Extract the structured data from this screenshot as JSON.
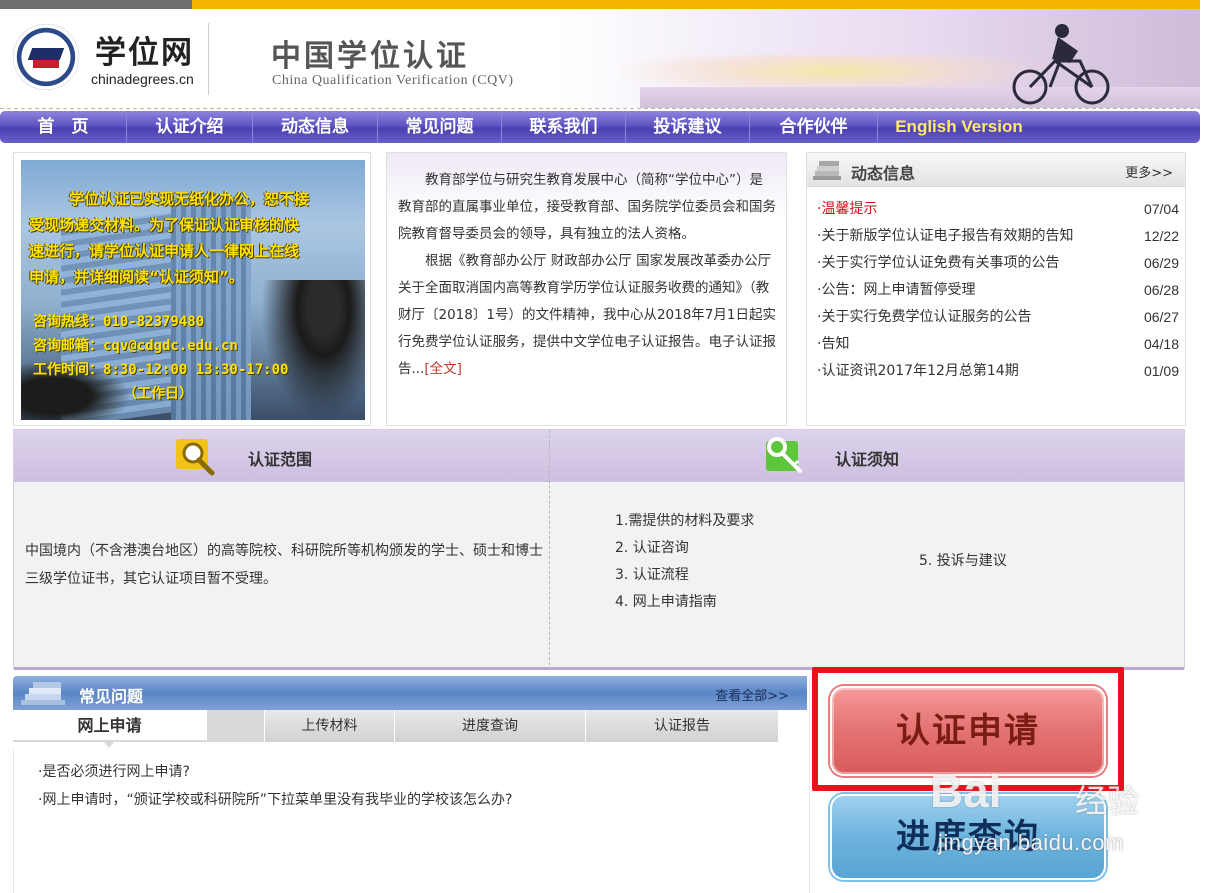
{
  "header": {
    "site_name": "学位网",
    "site_domain": "chinadegrees.cn",
    "title_cn": "中国学位认证",
    "title_en": "China Qualification Verification (CQV)"
  },
  "nav": {
    "items": [
      "首　页",
      "认证介绍",
      "动态信息",
      "常见问题",
      "联系我们",
      "投诉建议",
      "合作伙伴",
      "English Version"
    ]
  },
  "promo": {
    "lines": [
      "学位认证已实现无纸化办公，恕不接",
      "受现场递交材料。为了保证认证审核的快",
      "速进行，请学位认证申请人一律网上在线",
      "申请，并详细阅读“认证须知”。"
    ],
    "hotline": "咨询热线：010-82379480",
    "email": "咨询邮箱：cqv@cdgdc.edu.cn",
    "hours": "工作时间：8:30-12:00 13:30-17:00",
    "workday": "（工作日）"
  },
  "intro": {
    "para1": "教育部学位与研究生教育发展中心（简称“学位中心”）是教育部的直属事业单位，接受教育部、国务院学位委员会和国务院教育督导委员会的领导，具有独立的法人资格。",
    "para2": "根据《教育部办公厅 财政部办公厅 国家发展改革委办公厅关于全面取消国内高等教育学历学位认证服务收费的通知》（教财厅〔2018〕1号）的文件精神，我中心从2018年7月1日起实行免费学位认证服务，提供中文学位电子认证报告。电子认证报告...",
    "more": "[全文]"
  },
  "news": {
    "title": "动态信息",
    "more": "更多>>",
    "items": [
      {
        "title": "·温馨提示",
        "date": "07/04"
      },
      {
        "title": "·关于新版学位认证电子报告有效期的告知",
        "date": "12/22"
      },
      {
        "title": "·关于实行学位认证免费有关事项的公告",
        "date": "06/29"
      },
      {
        "title": "·公告：网上申请暂停受理",
        "date": "06/28"
      },
      {
        "title": "·关于实行免费学位认证服务的公告",
        "date": "06/27"
      },
      {
        "title": "·告知",
        "date": "04/18"
      },
      {
        "title": "·认证资讯2017年12月总第14期",
        "date": "01/09"
      }
    ]
  },
  "scope": {
    "title": "认证范围",
    "text": "中国境内（不含港澳台地区）的高等院校、科研院所等机构颁发的学士、硕士和博士三级学位证书，其它认证项目暂不受理。"
  },
  "notice": {
    "title": "认证须知",
    "items": [
      "1.需提供的材料及要求",
      "2. 认证咨询",
      "3. 认证流程",
      "4. 网上申请指南"
    ],
    "side": "5. 投诉与建议"
  },
  "faq": {
    "title": "常见问题",
    "view_all": "查看全部>>",
    "tabs": [
      "网上申请",
      "上传材料",
      "进度查询",
      "认证报告"
    ],
    "questions": [
      "·是否必须进行网上申请?",
      "·网上申请时，“颁证学校或科研院所”下拉菜单里没有我毕业的学校该怎么办?"
    ]
  },
  "actions": {
    "apply": "认证申请",
    "progress": "进度查询"
  },
  "watermark": {
    "brand": "Bai",
    "brand_cn": "经验",
    "url": "jingyan.baidu.com"
  },
  "colors": {
    "nav": "#5f54c2",
    "english_link": "#ffe96b",
    "highlight": "#e8121d",
    "apply_button": "#e57575",
    "progress_button": "#6cb3dd",
    "news_hot": "#d0121b"
  }
}
